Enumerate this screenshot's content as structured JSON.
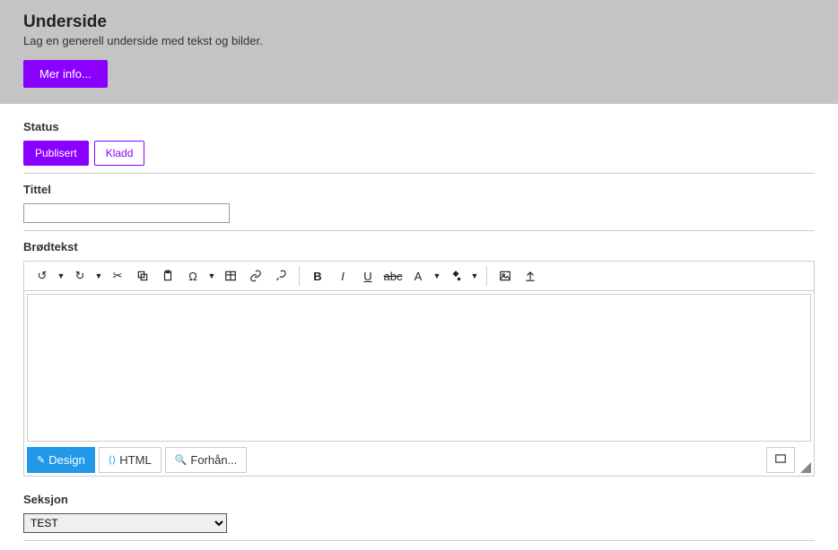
{
  "header": {
    "title": "Underside",
    "subtitle": "Lag en generell underside med tekst og bilder.",
    "more_info_label": "Mer info..."
  },
  "status": {
    "label": "Status",
    "published_label": "Publisert",
    "draft_label": "Kladd"
  },
  "title_field": {
    "label": "Tittel",
    "value": ""
  },
  "body": {
    "label": "Brødtekst",
    "tabs": {
      "design": "Design",
      "html": "HTML",
      "preview": "Forhån..."
    }
  },
  "section": {
    "label": "Seksjon",
    "selected": "TEST"
  }
}
